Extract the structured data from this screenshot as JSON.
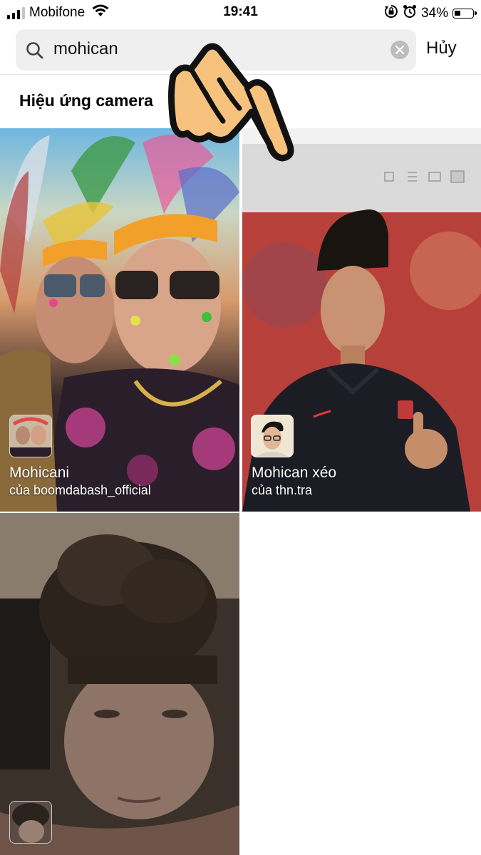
{
  "status_bar": {
    "carrier": "Mobifone",
    "time": "19:41",
    "battery": "34%",
    "battery_level": 0.34,
    "icons": [
      "signal-icon",
      "wifi-icon",
      "orientation-lock-icon",
      "alarm-icon",
      "battery-icon"
    ]
  },
  "search": {
    "value": "mohican",
    "cancel_label": "Hủy"
  },
  "section_title": "Hiệu ứng camera",
  "effects": [
    {
      "name": "Mohicani",
      "author": "của boomdabash_official"
    },
    {
      "name": "Mohican xéo",
      "author": "của thn.tra"
    },
    {
      "name": "",
      "author": ""
    }
  ],
  "colors": {
    "hand_fill": "#F6C27E",
    "hand_outline": "#111111"
  }
}
